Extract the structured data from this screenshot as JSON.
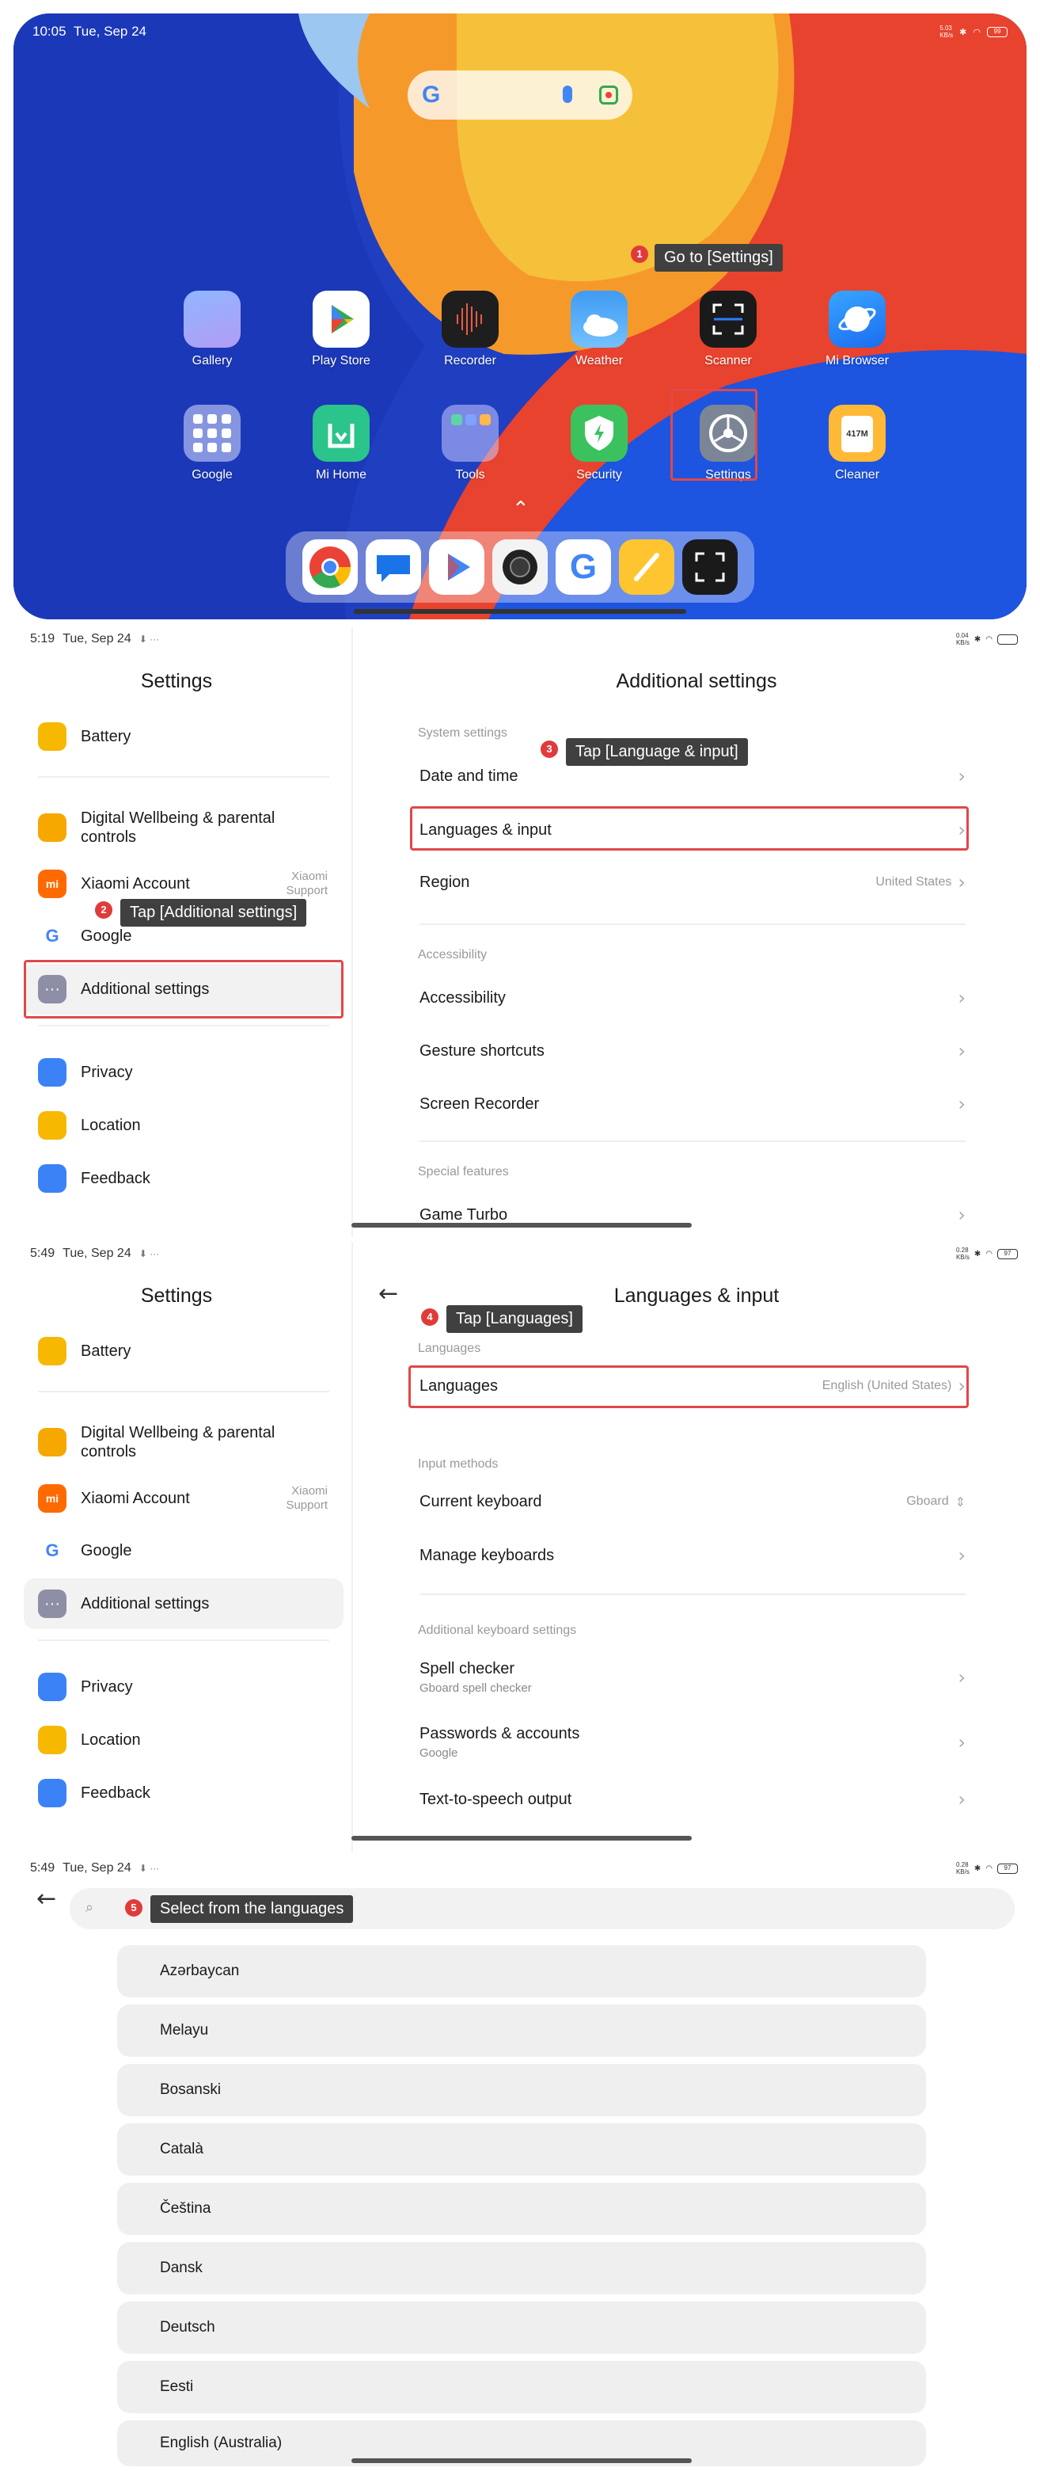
{
  "panel1": {
    "time": "10:05",
    "date": "Tue, Sep 24",
    "net_speed": "5.03\nKB/s",
    "battery": "99",
    "apps": [
      {
        "label": "Gallery",
        "icon": "gallery-icon"
      },
      {
        "label": "Play Store",
        "icon": "play-store-icon"
      },
      {
        "label": "Recorder",
        "icon": "recorder-icon"
      },
      {
        "label": "Weather",
        "icon": "weather-icon"
      },
      {
        "label": "Scanner",
        "icon": "scanner-icon"
      },
      {
        "label": "Mi Browser",
        "icon": "browser-icon"
      },
      {
        "label": "Google",
        "icon": "google-folder-icon"
      },
      {
        "label": "Mi Home",
        "icon": "mi-home-icon"
      },
      {
        "label": "Tools",
        "icon": "tools-folder-icon"
      },
      {
        "label": "Security",
        "icon": "security-icon"
      },
      {
        "label": "Settings",
        "icon": "settings-gear-icon"
      },
      {
        "label": "Cleaner",
        "icon": "cleaner-icon"
      }
    ],
    "cleaner_badge": "417M",
    "dock": [
      "chrome-icon",
      "messages-icon",
      "play-games-icon",
      "camera-icon",
      "google-icon",
      "notes-icon",
      "scanner-icon"
    ],
    "annotation": {
      "num": "1",
      "text": "Go to [Settings]"
    }
  },
  "panel2": {
    "time": "5:19",
    "date": "Tue, Sep 24",
    "net_speed": "0.04\nKB/s",
    "left_title": "Settings",
    "left_items": [
      {
        "label": "Battery"
      },
      {
        "label": "Digital Wellbeing & parental controls"
      },
      {
        "label": "Xiaomi Account",
        "sub": "Xiaomi\nSupport"
      },
      {
        "label": "Google"
      },
      {
        "label": "Additional settings"
      },
      {
        "label": "Privacy"
      },
      {
        "label": "Location"
      },
      {
        "label": "Feedback"
      }
    ],
    "right_title": "Additional settings",
    "sections": [
      "System settings",
      "Accessibility",
      "Special features"
    ],
    "rows": [
      {
        "label": "Date and time",
        "value": ""
      },
      {
        "label": "Languages & input",
        "value": ""
      },
      {
        "label": "Region",
        "value": "United States"
      },
      {
        "label": "Accessibility",
        "value": ""
      },
      {
        "label": "Gesture shortcuts",
        "value": ""
      },
      {
        "label": "Screen Recorder",
        "value": ""
      },
      {
        "label": "Game Turbo",
        "value": ""
      }
    ],
    "annotation2": {
      "num": "2",
      "text": "Tap [Additional settings]"
    },
    "annotation3": {
      "num": "3",
      "text": "Tap [Language & input]"
    }
  },
  "panel3": {
    "time": "5:49",
    "date": "Tue, Sep 24",
    "net_speed": "0.28\nKB/s",
    "battery": "97",
    "left_title": "Settings",
    "right_title": "Languages & input",
    "sections": [
      "Languages",
      "Input methods",
      "Additional keyboard settings"
    ],
    "rows": [
      {
        "label": "Languages",
        "value": "English (United States)",
        "sub": ""
      },
      {
        "label": "Current keyboard",
        "value": "Gboard",
        "sub": ""
      },
      {
        "label": "Manage keyboards",
        "value": "",
        "sub": ""
      },
      {
        "label": "Spell checker",
        "value": "",
        "sub": "Gboard spell checker"
      },
      {
        "label": "Passwords & accounts",
        "value": "",
        "sub": "Google"
      },
      {
        "label": "Text-to-speech output",
        "value": "",
        "sub": ""
      }
    ],
    "annotation": {
      "num": "4",
      "text": "Tap [Languages]"
    }
  },
  "panel4": {
    "time": "5:49",
    "date": "Tue, Sep 24",
    "net_speed": "0.28\nKB/s",
    "battery": "97",
    "languages": [
      "Azərbaycan",
      "Melayu",
      "Bosanski",
      "Català",
      "Čeština",
      "Dansk",
      "Deutsch",
      "Eesti",
      "English (Australia)"
    ],
    "annotation": {
      "num": "5",
      "text": "Select from the languages"
    }
  },
  "colors": {
    "annotation_red": "#e03b3b",
    "highlight_red": "#e04848",
    "tooltip_bg": "#404040"
  }
}
